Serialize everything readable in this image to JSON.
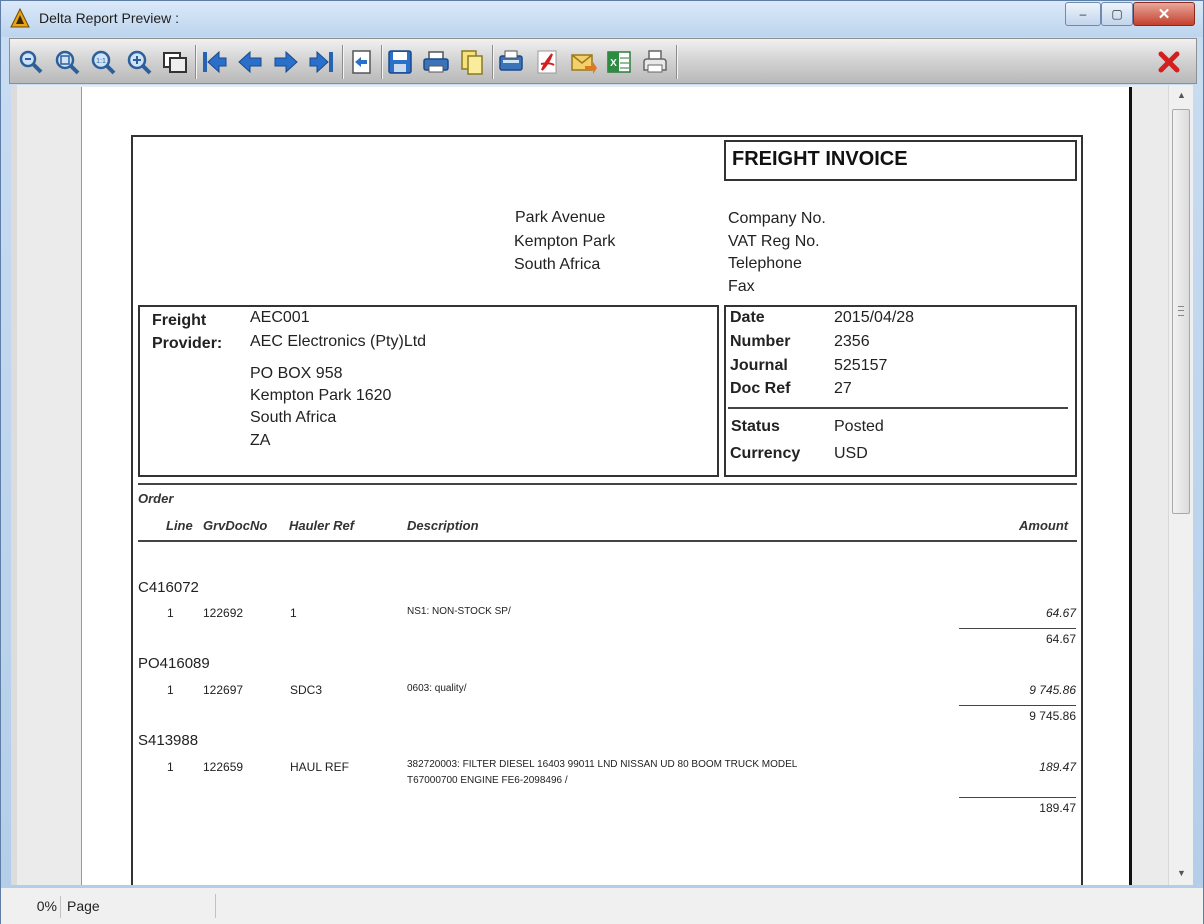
{
  "window": {
    "title": "Delta Report Preview :",
    "minimize_glyph": "‒",
    "maximize_glyph": "▢",
    "close_glyph": "✕"
  },
  "toolbar": {
    "buttons": [
      {
        "icon": "zoom-out-icon"
      },
      {
        "icon": "zoom-fit-icon"
      },
      {
        "icon": "zoom-100-icon"
      },
      {
        "icon": "zoom-in-icon"
      },
      {
        "icon": "page-width-icon"
      },
      {
        "icon": "first-page-icon"
      },
      {
        "icon": "previous-page-icon"
      },
      {
        "icon": "next-page-icon"
      },
      {
        "icon": "last-page-icon"
      },
      {
        "icon": "go-to-page-icon"
      },
      {
        "icon": "save-icon"
      },
      {
        "icon": "print-icon"
      },
      {
        "icon": "copy-icon"
      },
      {
        "icon": "fax-icon"
      },
      {
        "icon": "pdf-export-icon"
      },
      {
        "icon": "email-export-icon"
      },
      {
        "icon": "excel-export-icon"
      },
      {
        "icon": "printer-setup-icon"
      },
      {
        "icon": "close-preview-icon"
      }
    ]
  },
  "report": {
    "title": "FREIGHT INVOICE",
    "company_address": [
      "Park  Avenue",
      "Kempton Park",
      "South Africa"
    ],
    "company_labels": [
      "Company No.",
      "VAT Reg No.",
      "Telephone",
      "Fax"
    ],
    "provider_label_1": "Freight",
    "provider_label_2": "Provider:",
    "provider_code": "AEC001",
    "provider_name": "AEC Electronics (Pty)Ltd",
    "provider_address": [
      "PO BOX 958",
      "Kempton Park 1620",
      "South Africa",
      "ZA"
    ],
    "info": {
      "date_label": "Date",
      "date_value": "2015/04/28",
      "number_label": "Number",
      "number_value": "2356",
      "journal_label": "Journal",
      "journal_value": "525157",
      "docref_label": "Doc Ref",
      "docref_value": "27",
      "status_label": "Status",
      "status_value": "Posted",
      "currency_label": "Currency",
      "currency_value": "USD"
    },
    "table": {
      "order_label": "Order",
      "col_line": "Line",
      "col_grv": "GrvDocNo",
      "col_hauler": "Hauler Ref",
      "col_desc": "Description",
      "col_amount": "Amount"
    },
    "orders": [
      {
        "order": "C416072",
        "lines": [
          {
            "line": "1",
            "grv": "122692",
            "hauler": "1",
            "desc1": "NS1: NON-STOCK SP/",
            "desc2": "",
            "amount": "64.67"
          }
        ],
        "total": "64.67"
      },
      {
        "order": "PO416089",
        "lines": [
          {
            "line": "1",
            "grv": "122697",
            "hauler": "SDC3",
            "desc1": "0603: quality/",
            "desc2": "",
            "amount": "9 745.86"
          }
        ],
        "total": "9 745.86"
      },
      {
        "order": "S413988",
        "lines": [
          {
            "line": "1",
            "grv": "122659",
            "hauler": "HAUL REF",
            "desc1": "382720003: FILTER DIESEL 16403 99011 LND NISSAN UD 80 BOOM TRUCK MODEL",
            "desc2": "T67000700 ENGINE FE6-2098496 /",
            "amount": "189.47"
          }
        ],
        "total": "189.47"
      }
    ]
  },
  "status": {
    "percent": "0%",
    "page_label": "Page"
  }
}
